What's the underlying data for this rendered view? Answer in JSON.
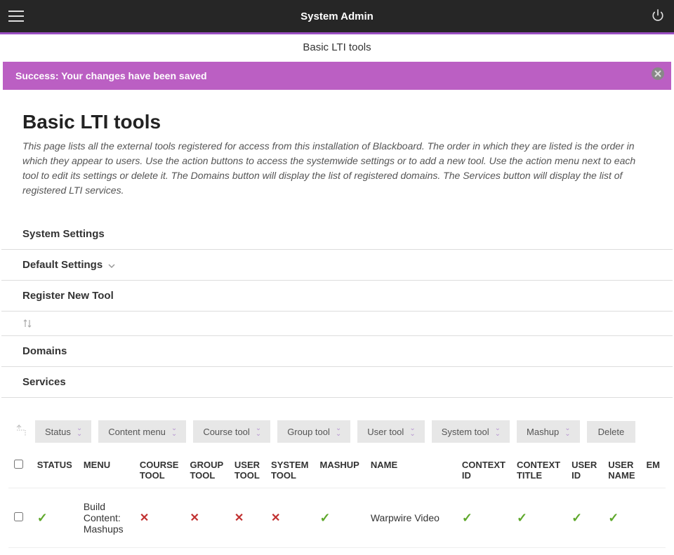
{
  "header": {
    "title": "System Admin",
    "subbar": "Basic LTI tools"
  },
  "banner": {
    "text": "Success: Your changes have been saved"
  },
  "page": {
    "title": "Basic LTI tools",
    "description": "This page lists all the external tools registered for access from this installation of Blackboard. The order in which they are listed is the order in which they appear to users. Use the action buttons to access the systemwide settings or to add a new tool. Use the action menu next to each tool to edit its settings or delete it. The Domains button will display the list of registered domains. The Services button will display the list of registered LTI services."
  },
  "actions": {
    "system_settings": "System Settings",
    "default_settings": "Default Settings",
    "register_new_tool": "Register New Tool",
    "domains": "Domains",
    "services": "Services"
  },
  "toolbar": {
    "status": "Status",
    "content_menu": "Content menu",
    "course_tool": "Course tool",
    "group_tool": "Group tool",
    "user_tool": "User tool",
    "system_tool": "System tool",
    "mashup": "Mashup",
    "delete": "Delete"
  },
  "table": {
    "columns": {
      "status": "STATUS",
      "menu": "MENU",
      "course_tool": "COURSE TOOL",
      "group_tool": "GROUP TOOL",
      "user_tool": "USER TOOL",
      "system_tool": "SYSTEM TOOL",
      "mashup": "MASHUP",
      "name": "NAME",
      "context_id": "CONTEXT ID",
      "context_title": "CONTEXT TITLE",
      "user_id": "USER ID",
      "user_name": "USER NAME",
      "email_cut": "EM"
    },
    "rows": [
      {
        "status": "check",
        "menu": "Build Content: Mashups",
        "course_tool": "x",
        "group_tool": "x",
        "user_tool": "x",
        "system_tool": "x",
        "mashup": "check",
        "name": "Warpwire Video",
        "context_id": "check",
        "context_title": "check",
        "user_id": "check",
        "user_name": "check"
      }
    ]
  }
}
